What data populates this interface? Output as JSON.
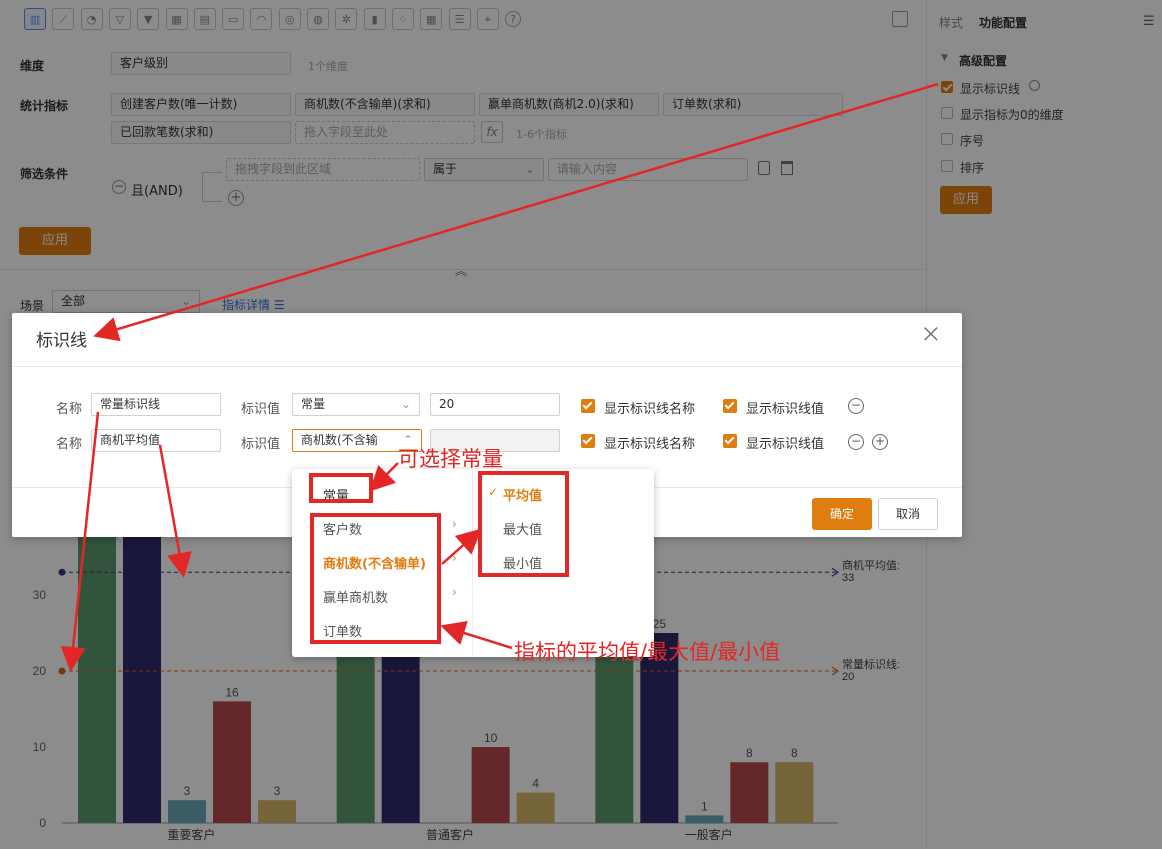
{
  "toolbar": {
    "icons": [
      "bar-chart",
      "line-chart",
      "pie-chart",
      "funnel",
      "funnel-2",
      "table",
      "bar-line-combo",
      "card",
      "gauge",
      "ring",
      "globe",
      "radar",
      "histogram",
      "scatter",
      "pivot",
      "detail-table",
      "map-point",
      "help"
    ]
  },
  "right_panel": {
    "tabs": [
      "样式",
      "功能配置"
    ],
    "section_title": "高级配置",
    "options": [
      {
        "label": "显示标识线",
        "checked": true
      },
      {
        "label": "显示指标为0的维度",
        "checked": false
      },
      {
        "label": "序号",
        "checked": false
      },
      {
        "label": "排序",
        "checked": false
      }
    ],
    "apply_label": "应用"
  },
  "config": {
    "dimension_label": "维度",
    "dimension_value": "客户级别",
    "dimension_hint": "1个维度",
    "metrics_label": "统计指标",
    "metrics": [
      "创建客户数(唯一计数)",
      "商机数(不含输单)(求和)",
      "赢单商机数(商机2.0)(求和)",
      "订单数(求和)",
      "已回款笔数(求和)"
    ],
    "metrics_drop_placeholder": "拖入字段至此处",
    "fx_label": "fx",
    "metrics_hint": "1-6个指标",
    "filter_label": "筛选条件",
    "filter_logic": "且(AND)",
    "filter_field_placeholder": "拖拽字段到此区域",
    "filter_operator": "属于",
    "filter_value_placeholder": "请输入内容",
    "apply_label": "应用",
    "scene_label": "场景",
    "scene_value": "全部",
    "metric_detail_label": "指标详情"
  },
  "dialog": {
    "title": "标识线",
    "rows": [
      {
        "name_label": "名称",
        "name_value": "常量标识线",
        "value_label": "标识值",
        "type_value": "常量",
        "number_value": "20",
        "show_name_label": "显示标识线名称",
        "show_value_label": "显示标识线值"
      },
      {
        "name_label": "名称",
        "name_value": "商机平均值",
        "value_label": "标识值",
        "type_value": "商机数(不含输",
        "number_value": "",
        "show_name_label": "显示标识线名称",
        "show_value_label": "显示标识线值"
      }
    ],
    "ok_label": "确定",
    "cancel_label": "取消"
  },
  "dropdown": {
    "items": [
      "常量",
      "客户数",
      "商机数(不含输单)",
      "赢单商机数",
      "订单数"
    ],
    "sub_items": [
      "平均值",
      "最大值",
      "最小值"
    ]
  },
  "annotations": {
    "constant_note": "可选择常量",
    "metric_note": "指标的平均值/最大值/最小值"
  },
  "chart_data": {
    "type": "bar",
    "categories": [
      "重要客户",
      "普通客户",
      "一般客户"
    ],
    "series": [
      {
        "color": "#5b9a6e",
        "values": [
          40,
          40,
          22
        ]
      },
      {
        "color": "#2f2d6e",
        "values": [
          40,
          40,
          25
        ]
      },
      {
        "color": "#6aaabb",
        "values": [
          3,
          0,
          1
        ]
      },
      {
        "color": "#b84a4e",
        "values": [
          16,
          10,
          8
        ]
      },
      {
        "color": "#d7b86a",
        "values": [
          3,
          4,
          8
        ]
      }
    ],
    "ylim": [
      0,
      40
    ],
    "yticks": [
      "0",
      "10",
      "20",
      "30"
    ],
    "value_labels": [
      [
        "",
        "",
        "3",
        "16",
        "3"
      ],
      [
        "",
        "",
        "",
        "10",
        "4"
      ],
      [
        "",
        "25",
        "1",
        "8",
        "8"
      ]
    ],
    "reference_lines": [
      {
        "label": "商机平均值:",
        "value_text": "33",
        "value": 33,
        "color": "#3a3a8c"
      },
      {
        "label": "常量标识线:",
        "value_text": "20",
        "value": 20,
        "color": "#d06a1e"
      }
    ]
  }
}
